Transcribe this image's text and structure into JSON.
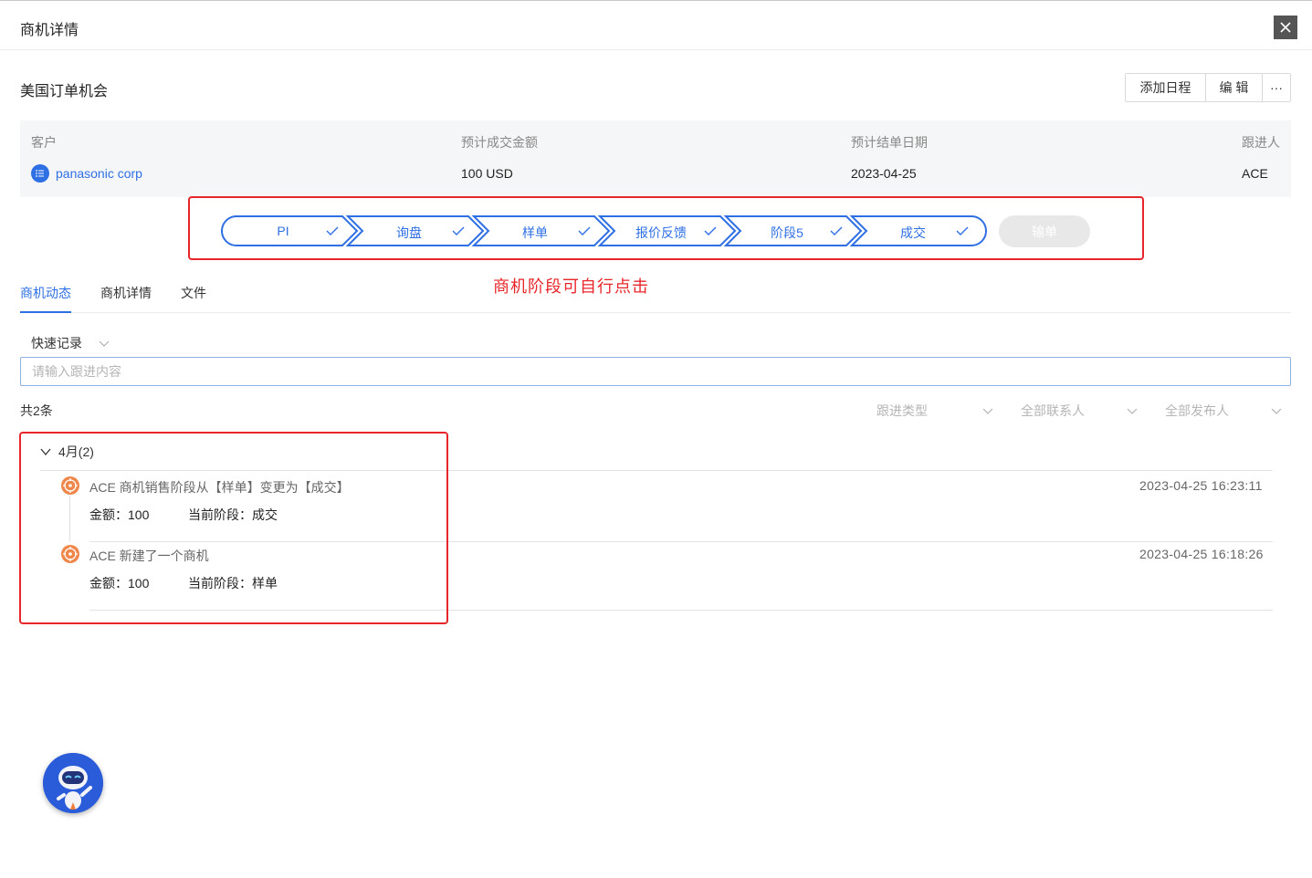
{
  "header": {
    "title": "商机详情",
    "close_icon": "close-icon"
  },
  "opportunity": {
    "name": "美国订单机会",
    "actions": {
      "add_schedule": "添加日程",
      "edit": "编 辑",
      "more": "···"
    }
  },
  "info": {
    "customer_label": "客户",
    "customer_value": "panasonic corp",
    "amount_label": "预计成交金额",
    "amount_value": "100 USD",
    "date_label": "预计结单日期",
    "date_value": "2023-04-25",
    "owner_label": "跟进人",
    "owner_value": "ACE"
  },
  "stages": {
    "items": [
      "PI",
      "询盘",
      "样单",
      "报价反馈",
      "阶段5",
      "成交"
    ],
    "completed": [
      true,
      true,
      true,
      true,
      true,
      true
    ],
    "lose_label": "输单",
    "accent_color": "#2f6fe4"
  },
  "annotation_stage": "商机阶段可自行点击",
  "tabs": {
    "items": [
      "商机动态",
      "商机详情",
      "文件"
    ],
    "active_index": 0
  },
  "quick_record": {
    "label": "快速记录",
    "placeholder": "请输入跟进内容"
  },
  "list": {
    "total": "共2条",
    "filters": [
      "跟进类型",
      "全部联系人",
      "全部发布人"
    ],
    "month": "4月(2)",
    "entries": [
      {
        "title": "ACE 商机销售阶段从【样单】变更为【成交】",
        "time": "2023-04-25 16:23:11",
        "amount": "金额：100",
        "stage": "当前阶段：成交"
      },
      {
        "title": "ACE 新建了一个商机",
        "time": "2023-04-25 16:18:26",
        "amount": "金额：100",
        "stage": "当前阶段：样单"
      }
    ]
  },
  "colors": {
    "accent": "#2f6fe4",
    "annotation": "#e8262a",
    "timeline_icon": "#f0874a"
  }
}
